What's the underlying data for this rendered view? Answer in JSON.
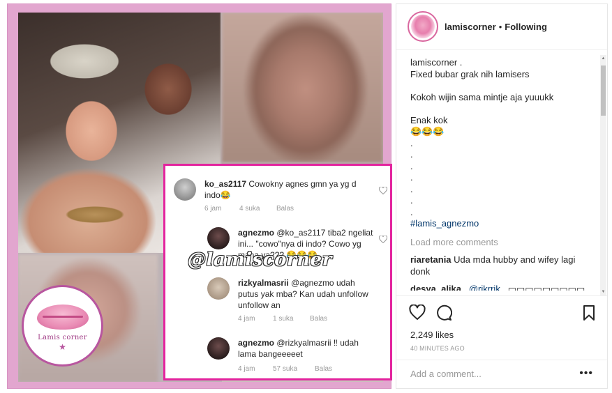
{
  "post_image": {
    "logo": {
      "title": "Lamis corner",
      "subtitle": "",
      "star": "★"
    },
    "watermark": "@lamiscorner",
    "embedded_comments": [
      {
        "username": "ko_as2117",
        "text": "Cowokny agnes gmn ya yg d indo😂",
        "time": "6 jam",
        "likes": "4 suka",
        "reply": "Balas"
      },
      {
        "username": "agnezmo",
        "text": "@ko_as2117 tiba2 ngeliat ini... \"cowo\"nya di indo? Cowo yg mana ya??? 😂😂😂",
        "time": "4 jam",
        "likes": "4 suka",
        "reply": "Balas"
      },
      {
        "username": "rizkyalmasrii",
        "text": "@agnezmo udah putus yak mba? Kan udah unfollow unfollow an",
        "time": "4 jam",
        "likes": "1 suka",
        "reply": "Balas"
      },
      {
        "username": "agnezmo",
        "text": "@rizkyalmasrii ‼ udah lama bangeeeeet",
        "time": "4 jam",
        "likes": "57 suka",
        "reply": "Balas"
      }
    ]
  },
  "header": {
    "username": "lamiscorner",
    "separator": "•",
    "follow_status": "Following"
  },
  "caption": {
    "lines": [
      "lamiscorner .",
      "Fixed bubar grak nih lamisers",
      "",
      "Kokoh wijin sama mintje aja yuuukk",
      "",
      "Enak kok",
      "😂😂😂",
      ".",
      ".",
      ".",
      ".",
      ".",
      ".",
      ".",
      "."
    ],
    "hashtag": "#lamis_agnezmo"
  },
  "load_more": "Load more comments",
  "comments": [
    {
      "username": "riaretania",
      "text": "Uda mda hubby and wifey lagi donk"
    },
    {
      "username": "desya_alika_",
      "mention": "@rikrrik_",
      "text": "▭▭▭▭▭▭▭▭▭"
    }
  ],
  "actions": {
    "icons": [
      "heart-icon",
      "comment-icon",
      "bookmark-icon"
    ],
    "likes": "2,249 likes",
    "time_ago": "40 MINUTES AGO"
  },
  "add_comment": {
    "placeholder": "Add a comment...",
    "more": "•••"
  },
  "colors": {
    "frame_pink": "#e2a6cf",
    "comment_border": "#e3249e",
    "hashtag_blue": "#003569",
    "muted": "#999999"
  }
}
